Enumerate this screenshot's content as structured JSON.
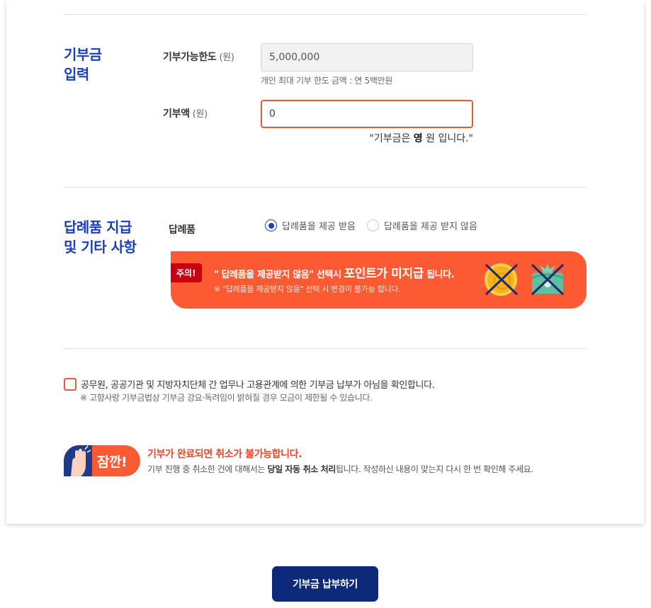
{
  "section_donation": {
    "title_line1": "기부금",
    "title_line2": "입력",
    "limit_label": "기부가능한도",
    "limit_unit": "(원)",
    "limit_value": "5,000,000",
    "limit_help": "개인 최대 기부 한도 금액 : 연 5백만원",
    "amount_label": "기부액",
    "amount_unit": "(원)",
    "amount_value": "0",
    "amount_text_prefix": "\"기부금은 ",
    "amount_text_bold": "영",
    "amount_text_suffix": " 원 입니다.\""
  },
  "section_gift": {
    "title_line1": "답례품 지급",
    "title_line2": "및 기타 사항",
    "label": "답례품",
    "options": [
      {
        "label": "답례품을 제공 받음",
        "selected": true
      },
      {
        "label": "답례품을 제공 받지 않음",
        "selected": false
      }
    ],
    "notice": {
      "tag": "주의!",
      "main_prefix": "\" 답례품을 제공받지 않음\" 선택시 ",
      "main_big": "포인트가 미지급",
      "main_suffix": " 됩니다.",
      "sub": "※ \"답례품을 제공받지 않음\" 선택 시 변경이 불가능 합니다.",
      "icons": [
        "coin-icon",
        "gift-icon"
      ],
      "bg_color": "#fb5a32",
      "tag_color": "#c90010"
    }
  },
  "agreement": {
    "checked": false,
    "text": "공무원, 공공기관 및 지방자치단체 간 업무나 고용관계에 의한 기부금 납부가 아님을 확인합니다.",
    "note": "※ 고향사랑 기부금법상 기부금 강요·독려임이 밝혀질 경우 모금이 제한될 수 있습니다."
  },
  "warning": {
    "badge": "잠깐!",
    "title": "기부가 완료되면 취소가 불가능합니다.",
    "desc_prefix": "기부 진행 중 취소한 건에 대해서는 ",
    "desc_bold": "당일 자동 취소 처리",
    "desc_suffix": "됩니다. 작성하신 내용이 맞는지 다시 한 번 확인해 주세요."
  },
  "submit_label": "기부금 납부하기",
  "colors": {
    "accent_blue": "#1a3fb8",
    "accent_orange": "#e85a34",
    "button_navy": "#0c2a79"
  }
}
